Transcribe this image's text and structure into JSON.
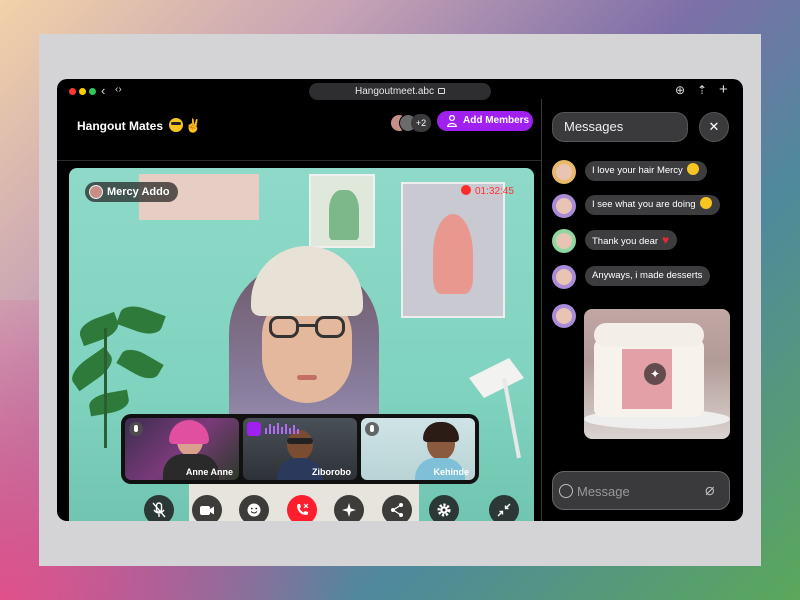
{
  "browser": {
    "url": "Hangoutmeet.abc",
    "dots": [
      "#ff3b30",
      "#ffcc00",
      "#34c759"
    ]
  },
  "room": {
    "title": "Hangout Mates",
    "extra_members": "+2",
    "add_members_label": "Add Members"
  },
  "video": {
    "speaker_name": "Mercy Addo",
    "recording_time": "01:32:45",
    "participants": [
      {
        "name": "Anne Anne",
        "status": "muted"
      },
      {
        "name": "Ziborobo",
        "status": "speaking"
      },
      {
        "name": "Kehinde",
        "status": "muted"
      }
    ]
  },
  "controls": [
    {
      "name": "mute-button",
      "icon": "mic-off-icon"
    },
    {
      "name": "camera-button",
      "icon": "video-camera-icon"
    },
    {
      "name": "emoji-button",
      "icon": "smiley-icon"
    },
    {
      "name": "end-call-button",
      "icon": "phone-end-icon",
      "color": "#ff1e2d"
    },
    {
      "name": "effects-button",
      "icon": "sparkle-icon"
    },
    {
      "name": "share-button",
      "icon": "share-icon"
    },
    {
      "name": "settings-button",
      "icon": "gear-icon"
    },
    {
      "name": "minimize-button",
      "icon": "collapse-icon"
    }
  ],
  "chat": {
    "title": "Messages",
    "messages": [
      {
        "text": "I love your hair Mercy",
        "emoji": "heart-eyes"
      },
      {
        "text": "I see what you are doing",
        "emoji": "wink"
      },
      {
        "text": "Thank you dear",
        "emoji": "heart"
      },
      {
        "text": "Anyways, i made desserts"
      }
    ],
    "image_message": "cake-photo",
    "input_placeholder": "Message"
  },
  "colors": {
    "accent": "#a020f0",
    "end_call": "#ff1e2d",
    "recording": "#ff2a2a"
  }
}
